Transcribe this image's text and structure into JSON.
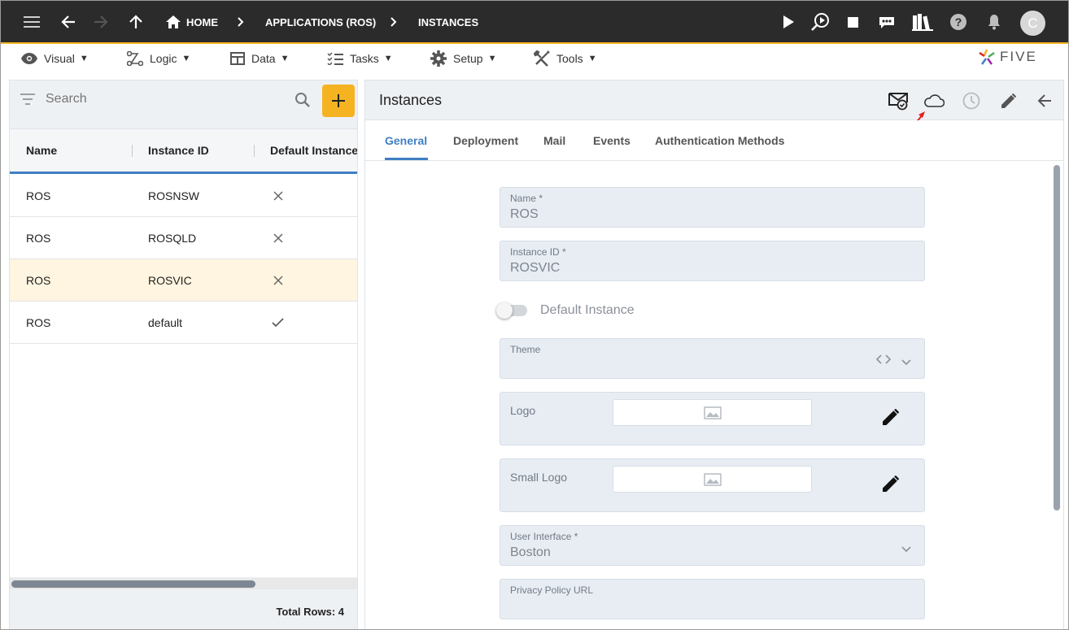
{
  "topbar": {
    "breadcrumbs": [
      "HOME",
      "APPLICATIONS (ROS)",
      "INSTANCES"
    ],
    "avatar_letter": "C",
    "icons": [
      "menu-icon",
      "back-arrow-icon",
      "forward-arrow-icon",
      "up-arrow-icon",
      "home-icon",
      "play-icon",
      "run-inspect-icon",
      "stop-icon",
      "chat-bot-icon",
      "library-icon",
      "help-icon",
      "bell-icon"
    ]
  },
  "menu": {
    "items": [
      {
        "label": "Visual",
        "icon": "eye-icon"
      },
      {
        "label": "Logic",
        "icon": "logic-icon"
      },
      {
        "label": "Data",
        "icon": "table-icon"
      },
      {
        "label": "Tasks",
        "icon": "checklist-icon"
      },
      {
        "label": "Setup",
        "icon": "gear-icon"
      },
      {
        "label": "Tools",
        "icon": "tools-icon"
      }
    ],
    "caret": "▼",
    "logo_text": "FIVE"
  },
  "list": {
    "search_placeholder": "Search",
    "columns": [
      "Name",
      "Instance ID",
      "Default Instance"
    ],
    "rows": [
      {
        "name": "ROS",
        "instance_id": "ROSNSW",
        "default": false
      },
      {
        "name": "ROS",
        "instance_id": "ROSQLD",
        "default": false
      },
      {
        "name": "ROS",
        "instance_id": "ROSVIC",
        "default": false,
        "selected": true
      },
      {
        "name": "ROS",
        "instance_id": "default",
        "default": true
      }
    ],
    "total_rows": "Total Rows: 4"
  },
  "detail": {
    "title": "Instances",
    "tabs": [
      "General",
      "Deployment",
      "Mail",
      "Events",
      "Authentication Methods"
    ],
    "active_tab": "General",
    "fields": {
      "name_label": "Name *",
      "name_value": "ROS",
      "instance_id_label": "Instance ID *",
      "instance_id_value": "ROSVIC",
      "default_instance_label": "Default Instance",
      "default_instance_on": false,
      "theme_label": "Theme",
      "logo_label": "Logo",
      "small_logo_label": "Small Logo",
      "ui_label": "User Interface *",
      "ui_value": "Boston",
      "privacy_label": "Privacy Policy URL"
    }
  },
  "colors": {
    "topbar_bg": "#2b2b2b",
    "accent": "#f5b321",
    "primary_blue": "#3f7fc4",
    "field_bg": "#e8edf3",
    "selected_row": "#fff5e0",
    "annotation_red": "#e02020"
  }
}
